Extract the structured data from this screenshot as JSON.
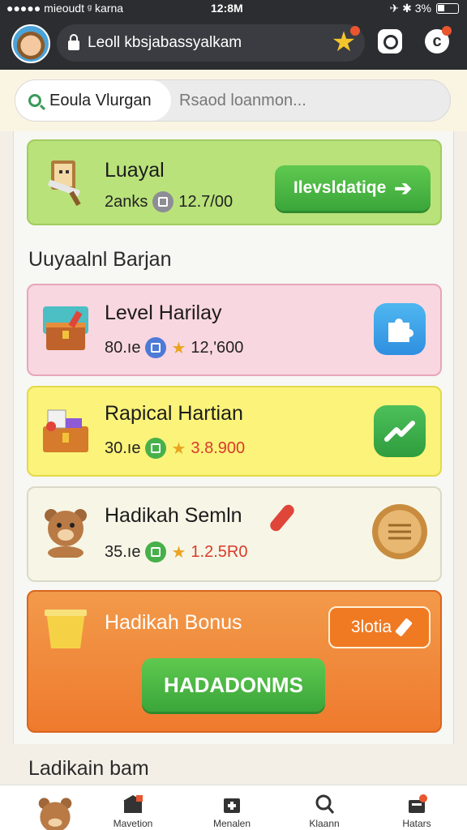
{
  "status_bar": {
    "carrier": "●●●●● mieoudt ᵍ karna",
    "time": "12:8M",
    "battery_text": "✈ ✱ 3%"
  },
  "app_bar": {
    "url": "Leoll kbsjabassyalkam"
  },
  "search": {
    "pill_label": "Eoula Vlurgan",
    "placeholder": "Rsaod loanmon..."
  },
  "featured": {
    "title": "Luayal",
    "sub_label": "2anks",
    "value": "12.7/00",
    "button_label": "Ilevsldatiqe"
  },
  "section_heading": "Uuyaalnl Barjan",
  "items": [
    {
      "title": "Level Harilay",
      "sub_label": "80.ıe",
      "value": "12,ʹ600",
      "color": "#f9d7e1",
      "border": "#e6a7b8",
      "coin": "#4d7ad6"
    },
    {
      "title": "Rapical Hartian",
      "sub_label": "30.ıe",
      "value": "3.8.900",
      "color": "#fbf37a",
      "border": "#e3d94a",
      "coin": "#47b04a"
    },
    {
      "title": "Hadikah Semln",
      "sub_label": "35.ıe",
      "value": "1.2.5R0",
      "color": "#f7f6e6",
      "border": "#dad9c7",
      "coin": "#47b04a"
    }
  ],
  "bonus": {
    "title": "Hadikah Bonus",
    "tag_label": "3lotia",
    "button_label": "HADADONMS"
  },
  "footer_heading": "Ladikain bam",
  "tabs": [
    {
      "label": ""
    },
    {
      "label": "Mavetion"
    },
    {
      "label": "Menalen"
    },
    {
      "label": "Klaann"
    },
    {
      "label": "Hatars"
    }
  ]
}
